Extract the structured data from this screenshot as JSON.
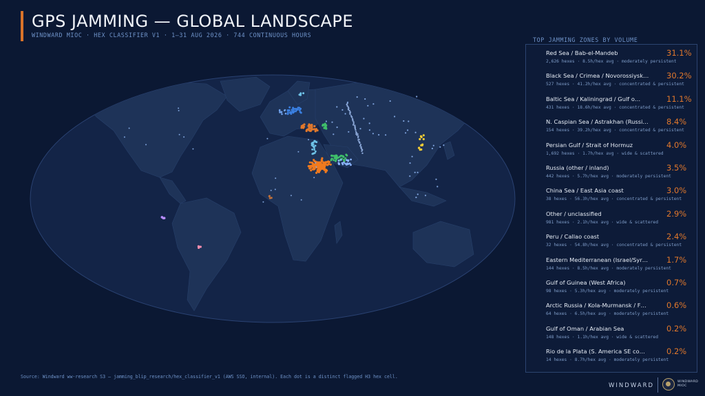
{
  "header": {
    "title": "GPS JAMMING — GLOBAL LANDSCAPE",
    "subtitle": "WINDWARD MIOC  ·  HEX CLASSIFIER V1  ·  1–31 AUG 2026  ·  744 CONTINUOUS HOURS",
    "accent_color": "#d9732a"
  },
  "panel": {
    "title": "TOP JAMMING ZONES BY VOLUME",
    "zones": [
      {
        "name": "Red Sea / Bab-el-Mandeb",
        "pct": "31.1%",
        "stats": "2,626 hexes  ·  8.5h/hex avg  ·  moderately persistent"
      },
      {
        "name": "Black Sea / Crimea / Novorossiysk…",
        "pct": "30.2%",
        "stats": "527 hexes  ·  41.2h/hex avg  ·  concentrated & persistent"
      },
      {
        "name": "Baltic Sea / Kaliningrad / Gulf o…",
        "pct": "11.1%",
        "stats": "431 hexes  ·  18.6h/hex avg  ·  concentrated & persistent"
      },
      {
        "name": "N. Caspian Sea / Astrakhan (Russi…",
        "pct": "8.4%",
        "stats": "154 hexes  ·  39.2h/hex avg  ·  concentrated & persistent"
      },
      {
        "name": "Persian Gulf / Strait of Hormuz",
        "pct": "4.0%",
        "stats": "1,692 hexes  ·  1.7h/hex avg  ·  wide & scattered"
      },
      {
        "name": "Russia (other / inland)",
        "pct": "3.5%",
        "stats": "442 hexes  ·  5.7h/hex avg  ·  moderately persistent"
      },
      {
        "name": "China Sea / East Asia coast",
        "pct": "3.0%",
        "stats": "38 hexes  ·  56.3h/hex avg  ·  concentrated & persistent"
      },
      {
        "name": "Other / unclassified",
        "pct": "2.9%",
        "stats": "981 hexes  ·  2.1h/hex avg  ·  wide & scattered"
      },
      {
        "name": "Peru / Callao coast",
        "pct": "2.4%",
        "stats": "32 hexes  ·  54.8h/hex avg  ·  concentrated & persistent"
      },
      {
        "name": "Eastern Mediterranean (Israel/Syr…",
        "pct": "1.7%",
        "stats": "144 hexes  ·  8.5h/hex avg  ·  moderately persistent"
      },
      {
        "name": "Gulf of Guinea (West Africa)",
        "pct": "0.7%",
        "stats": "98 hexes  ·  5.3h/hex avg  ·  moderately persistent"
      },
      {
        "name": "Arctic Russia / Kola-Murmansk / F…",
        "pct": "0.6%",
        "stats": "64 hexes  ·  6.5h/hex avg  ·  moderately persistent"
      },
      {
        "name": "Gulf of Oman / Arabian Sea",
        "pct": "0.2%",
        "stats": "148 hexes  ·  1.1h/hex avg  ·  wide & scattered"
      },
      {
        "name": "Rio de la Plata (S. America SE co…",
        "pct": "0.2%",
        "stats": "14 hexes  ·  8.7h/hex avg  ·  moderately persistent"
      }
    ]
  },
  "map": {
    "colors": {
      "ocean": "#132447",
      "land": "#1e3358",
      "red_sea": "#f07a1e",
      "black_sea": "#e0782c",
      "baltic": "#3a7fe0",
      "caspian": "#3fbf6a",
      "persian_gulf": "#8ab4ff",
      "east_asia": "#f2cc35",
      "east_med": "#6fc3e8",
      "peru": "#b78cff",
      "rio_plata": "#ff8fb0",
      "guinea": "#c0703a",
      "other": "#7fa3dc"
    }
  },
  "footer": {
    "source": "Source: Windward ww-research S3 — jamming_blip_research/hex_classifier_v1 (AWS SSO, internal). Each dot is a distinct flagged H3 hex cell.",
    "brand": "WINDWARD",
    "brand_small_line1": "WINDWARD",
    "brand_small_line2": "MIOC"
  }
}
